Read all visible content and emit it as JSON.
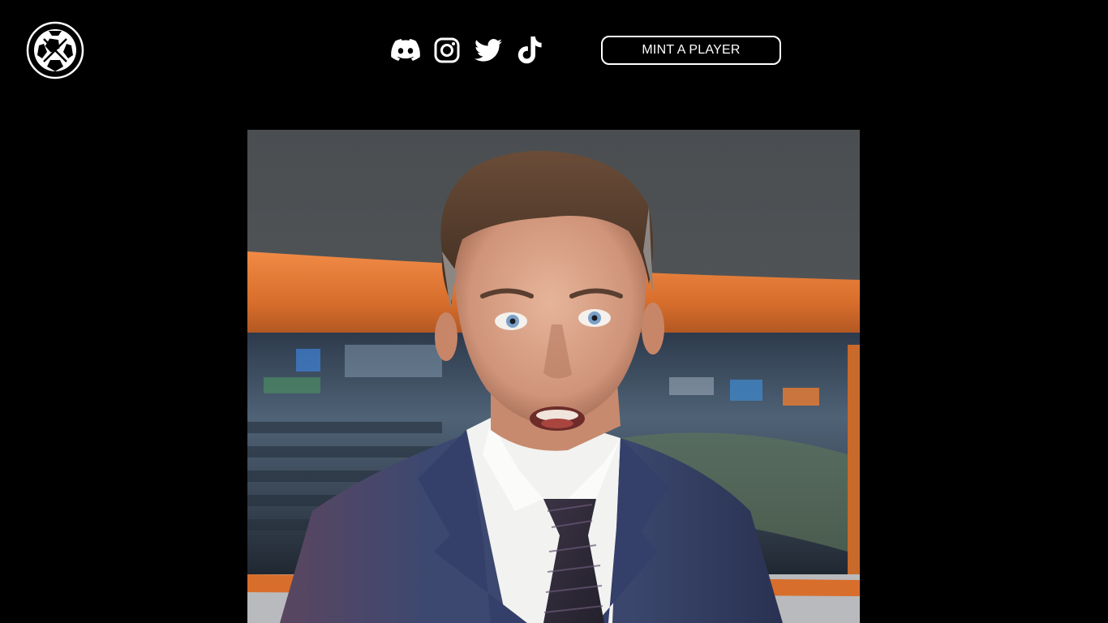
{
  "header": {
    "logo_icon": "soccer-ball-icon",
    "social_links": [
      {
        "name": "discord",
        "icon": "discord-icon"
      },
      {
        "name": "instagram",
        "icon": "instagram-icon"
      },
      {
        "name": "twitter",
        "icon": "twitter-icon"
      },
      {
        "name": "tiktok",
        "icon": "tiktok-icon"
      }
    ],
    "cta_label": "MINT A PLAYER"
  },
  "hero": {
    "media": "video-frame",
    "subject": "sports-news-anchor",
    "background": "stadium-studio"
  },
  "colors": {
    "page_background": "#000000",
    "foreground": "#ffffff",
    "studio_orange": "#e07a35",
    "studio_grey": "#4c5053",
    "suit_navy": "#3c4870"
  }
}
